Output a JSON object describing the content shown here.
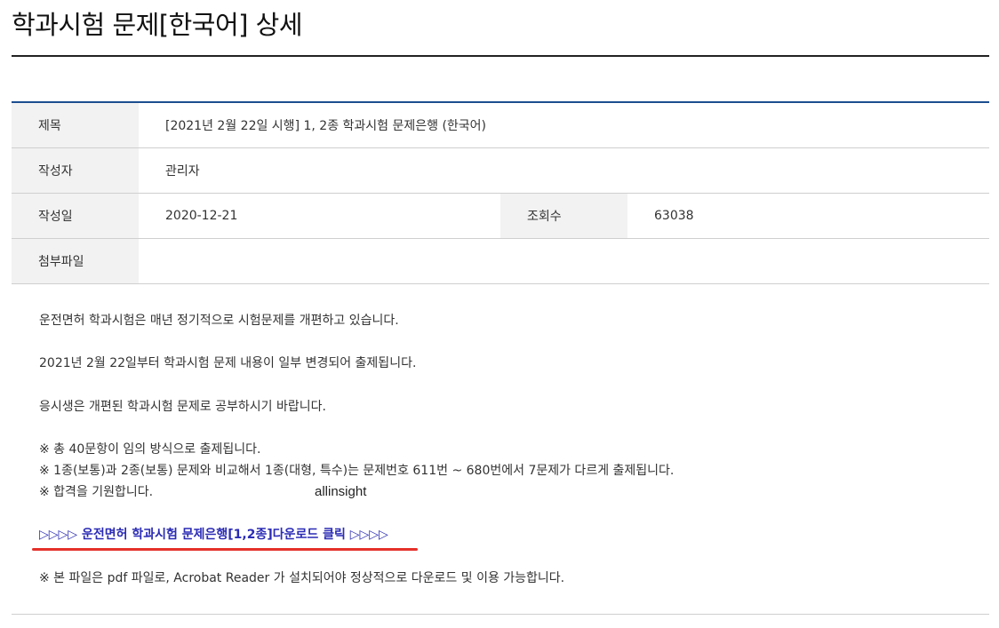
{
  "page": {
    "title": "학과시험 문제[한국어] 상세"
  },
  "info": {
    "subject_label": "제목",
    "subject_value": "[2021년 2월 22일 시행] 1, 2종 학과시험 문제은행 (한국어)",
    "author_label": "작성자",
    "author_value": "관리자",
    "date_label": "작성일",
    "date_value": "2020-12-21",
    "views_label": "조회수",
    "views_value": "63038",
    "attachment_label": "첨부파일",
    "attachment_value": ""
  },
  "content": {
    "line1": "운전면허 학과시험은 매년 정기적으로 시험문제를 개편하고 있습니다.",
    "line2": "2021년 2월 22일부터 학과시험 문제 내용이 일부 변경되어 출제됩니다.",
    "line3": "응시생은 개편된 학과시험 문제로 공부하시기 바랍니다.",
    "note1": "※ 총 40문항이 임의 방식으로 출제됩니다.",
    "note2": "※ 1종(보통)과 2종(보통) 문제와 비교해서 1종(대형, 특수)는 문제번호     611번 ~ 680번에서 7문제가 다르게 출제됩니다.",
    "note3": "※ 합격을 기원합니다.",
    "watermark": "allinsight",
    "download_link": "▷▷▷▷ 운전면허 학과시험 문제은행[1,2종]다운로드 클릭 ▷▷▷▷",
    "footer_note": "※ 본 파일은 pdf 파일로, Acrobat Reader 가 설치되어야 정상적으로 다운로드 및 이용 가능합니다."
  },
  "colors": {
    "table_top_border": "#1c4e8f",
    "label_background": "#f2f2f2",
    "link": "#2b2bb5",
    "highlight_underline": "#e5302a"
  }
}
